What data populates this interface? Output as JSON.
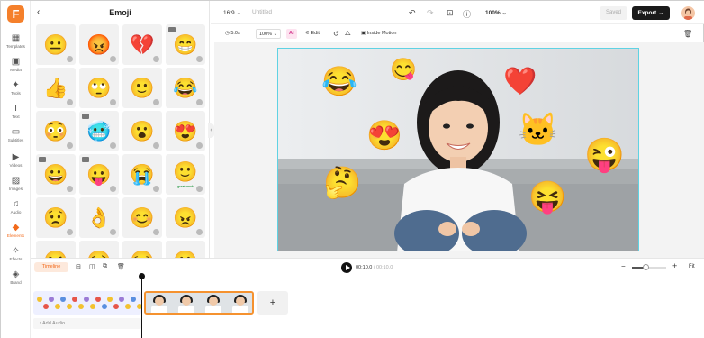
{
  "app": {
    "logo_letter": "F"
  },
  "rail": {
    "items": [
      {
        "label": "Templates",
        "icon": "templates-icon"
      },
      {
        "label": "Media",
        "icon": "media-icon"
      },
      {
        "label": "Tools",
        "icon": "ai-tools-icon"
      },
      {
        "label": "Text",
        "icon": "text-icon"
      },
      {
        "label": "Subtitles",
        "icon": "subtitles-icon"
      },
      {
        "label": "Videos",
        "icon": "videos-icon"
      },
      {
        "label": "Images",
        "icon": "images-icon"
      },
      {
        "label": "Audio",
        "icon": "audio-icon"
      },
      {
        "label": "Elements",
        "icon": "elements-icon",
        "active": true
      },
      {
        "label": "Effects",
        "icon": "effects-icon"
      },
      {
        "label": "Brand",
        "icon": "brand-icon"
      }
    ]
  },
  "panel": {
    "title": "Emoji",
    "back_icon": "chevron-left-icon",
    "emojis": [
      "😐",
      "😡",
      "💔",
      "😁",
      "👍",
      "🙄",
      "🙂",
      "😂",
      "😳",
      "🥶",
      "😮",
      "😍",
      "😀",
      "😛",
      "😭",
      "🙂",
      "😟",
      "👌",
      "😊",
      "😠",
      "😆",
      "😣",
      "😏",
      "🙁"
    ],
    "emoji_caption": "great work"
  },
  "topbar": {
    "aspect": "16:9",
    "project_name": "Untitled",
    "zoom": "100%",
    "saved_label": "Saved",
    "export_label": "Export"
  },
  "edit_bar": {
    "duration": "5.0s",
    "zoom": "100%",
    "ai_label": "AI",
    "edit_label": "Edit",
    "inside_motion_label": "Inside Motion"
  },
  "canvas": {
    "stickers": [
      "😂",
      "😋",
      "❤️",
      "😍",
      "🐱",
      "😜",
      "🤔",
      "😝"
    ]
  },
  "timeline": {
    "tab_label": "Timeline",
    "time": "00:10.0",
    "total": "/ 00:10.0",
    "fit_label": "Fit",
    "add_audio_label": "Add Audio",
    "add_clip_symbol": "+",
    "zoom_fraction": 0.4
  },
  "colors": {
    "accent": "#f26a1b",
    "selection": "#5fd2e3",
    "clip_border": "#f5922f"
  }
}
